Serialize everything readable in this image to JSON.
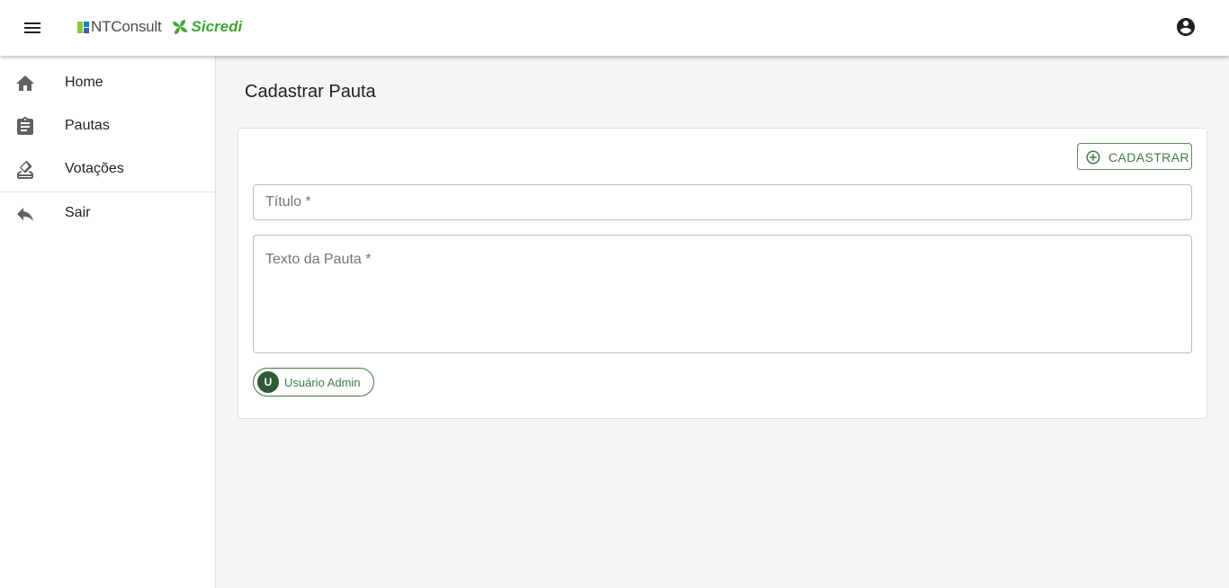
{
  "appbar": {
    "menu_icon": "menu-icon",
    "logo": {
      "brand_1": "NTConsult",
      "brand_2": "Sicredi"
    },
    "account_icon": "account-circle-icon"
  },
  "drawer": {
    "items": [
      {
        "label": "Home",
        "icon": "home-icon"
      },
      {
        "label": "Pautas",
        "icon": "assignment-icon"
      },
      {
        "label": "Votações",
        "icon": "how-to-vote-icon"
      },
      {
        "label": "Sair",
        "icon": "reply-icon"
      }
    ]
  },
  "main": {
    "page_title": "Cadastrar Pauta",
    "form": {
      "submit_label": "CADASTRAR",
      "submit_icon": "add-circle-outline-icon",
      "title_placeholder": "Título *",
      "text_placeholder": "Texto da Pauta *",
      "user_chip": {
        "initial": "U",
        "label": "Usuário Admin"
      }
    }
  },
  "colors": {
    "accent": "#3e7a45",
    "chip_avatar": "#2e5a36",
    "sicredi_green": "#3fa535",
    "background": "#f5f5f5"
  }
}
